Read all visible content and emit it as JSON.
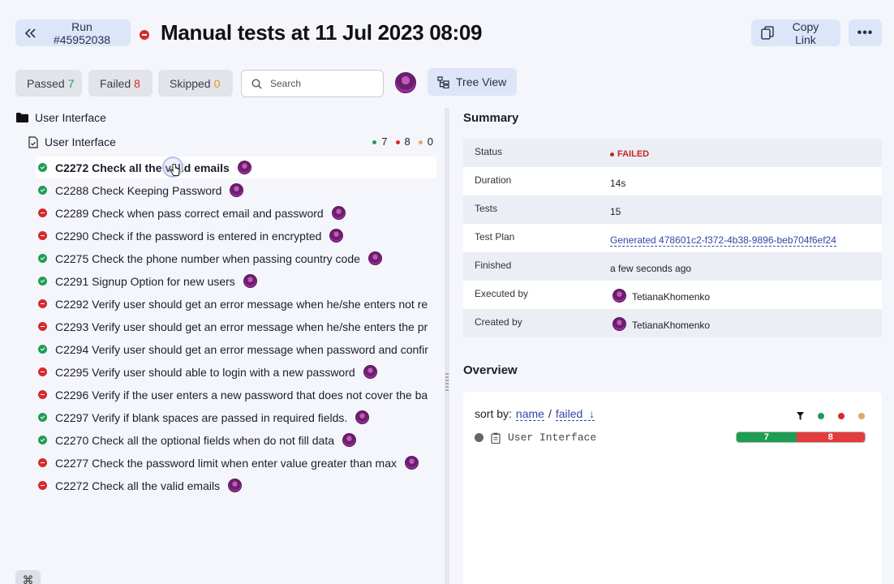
{
  "header": {
    "run_label": "Run #45952038",
    "title": "Manual tests at 11 Jul 2023 08:09",
    "copy_link_label": "Copy Link",
    "more_label": "•••"
  },
  "filters": {
    "passed_label": "Passed",
    "passed_count": "7",
    "failed_label": "Failed",
    "failed_count": "8",
    "skipped_label": "Skipped",
    "skipped_count": "0",
    "search_placeholder": "Search",
    "tree_view_label": "Tree View"
  },
  "tree": {
    "folder_label": "User Interface",
    "suite_label": "User Interface",
    "suite_counts": {
      "passed": "7",
      "failed": "8",
      "skipped": "0"
    },
    "tests": [
      {
        "label": "C2272 Check all the valid emails",
        "status": "passed"
      },
      {
        "label": "C2288 Check Keeping Password",
        "status": "passed"
      },
      {
        "label": "C2289 Check when pass correct email and password",
        "status": "failed"
      },
      {
        "label": "C2290 Check if the password is entered in encrypted",
        "status": "failed"
      },
      {
        "label": "C2275 Check the phone number when passing country code",
        "status": "passed"
      },
      {
        "label": "C2291 Signup Option for new users",
        "status": "passed"
      },
      {
        "label": "C2292 Verify user should get an error message when he/she enters not re",
        "status": "failed"
      },
      {
        "label": "C2293 Verify user should get an error message when he/she enters the pr",
        "status": "failed"
      },
      {
        "label": "C2294 Verify user should get an error message when password and confir",
        "status": "passed"
      },
      {
        "label": "C2295 Verify user should able to login with a new password",
        "status": "failed"
      },
      {
        "label": "C2296 Verify if the user enters a new password that does not cover the ba",
        "status": "failed"
      },
      {
        "label": "C2297 Verify if blank spaces are passed in required fields.",
        "status": "passed"
      },
      {
        "label": "C2270 Check all the optional fields when do not fill data",
        "status": "passed"
      },
      {
        "label": "C2277 Check the password limit when enter value greater than max",
        "status": "failed"
      },
      {
        "label": "C2272 Check all the valid emails",
        "status": "failed"
      }
    ]
  },
  "summary": {
    "title": "Summary",
    "rows": [
      {
        "key": "Status",
        "value": "FAILED"
      },
      {
        "key": "Duration",
        "value": "14s"
      },
      {
        "key": "Tests",
        "value": "15"
      },
      {
        "key": "Test Plan",
        "value": "Generated 478601c2-f372-4b38-9896-beb704f6ef24"
      },
      {
        "key": "Finished",
        "value": "a few seconds ago"
      },
      {
        "key": "Executed by",
        "value": "TetianaKhomenko"
      },
      {
        "key": "Created by",
        "value": "TetianaKhomenko"
      }
    ]
  },
  "overview": {
    "title": "Overview",
    "sort_by_label": "sort by:",
    "sort_name": "name",
    "sort_separator": "/",
    "sort_failed": "failed",
    "sort_arrow": "↓",
    "row_label": "User Interface",
    "passed": "7",
    "failed": "8",
    "passed_fraction": 0.4667
  },
  "colors": {
    "passed": "#1f9d55",
    "failed": "#d42b2b",
    "skipped": "#e5a66b",
    "accent_button": "#dde5f9"
  },
  "icons": {
    "run_back": "double-chevron-left-icon",
    "copy": "copy-icon",
    "search": "search-icon",
    "tree_view": "tree-view-icon",
    "folder": "folder-icon",
    "suite": "file-check-icon",
    "keyboard": "command-key-icon"
  }
}
